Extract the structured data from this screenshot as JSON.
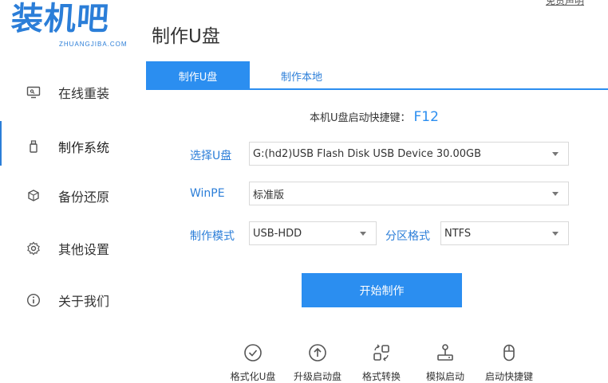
{
  "brand": {
    "name": "装机吧",
    "sub": "ZHUANGJIBA.COM"
  },
  "top_link": "免责声明",
  "page_title": "制作U盘",
  "sidebar": {
    "items": [
      {
        "label": "在线重装",
        "icon": "monitor-icon",
        "active": false
      },
      {
        "label": "制作系统",
        "icon": "usb-drive-icon",
        "active": true
      },
      {
        "label": "备份还原",
        "icon": "backup-cube-icon",
        "active": false
      },
      {
        "label": "其他设置",
        "icon": "gear-icon",
        "active": false
      },
      {
        "label": "关于我们",
        "icon": "info-icon",
        "active": false
      }
    ]
  },
  "tabs": [
    {
      "label": "制作U盘",
      "active": true
    },
    {
      "label": "制作本地",
      "active": false
    }
  ],
  "hotkey": {
    "label": "本机U盘启动快捷键：",
    "key": "F12"
  },
  "form": {
    "device_label": "选择U盘",
    "device_value": "G:(hd2)USB Flash Disk USB Device 30.00GB",
    "winpe_label": "WinPE",
    "winpe_value": "标准版",
    "mode_label": "制作模式",
    "mode_value": "USB-HDD",
    "partition_label": "分区格式",
    "partition_value": "NTFS"
  },
  "start_button": "开始制作",
  "tools": [
    {
      "label": "格式化U盘",
      "icon": "check-circle-icon"
    },
    {
      "label": "升级启动盘",
      "icon": "upload-circle-icon"
    },
    {
      "label": "格式转换",
      "icon": "convert-icon"
    },
    {
      "label": "模拟启动",
      "icon": "joystick-icon"
    },
    {
      "label": "启动快捷键",
      "icon": "mouse-icon"
    }
  ],
  "colors": {
    "accent": "#2b8ef0",
    "brand": "#2b7ed8"
  }
}
